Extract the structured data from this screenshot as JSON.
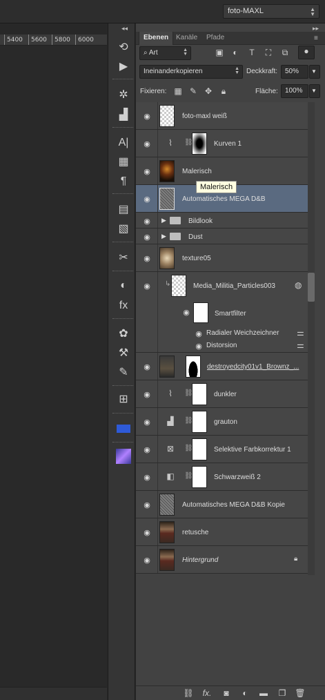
{
  "topbar": {
    "workspace": "foto-MAXL"
  },
  "ruler": {
    "ticks": [
      "5400",
      "5600",
      "5800",
      "6000"
    ]
  },
  "toolstrip": {
    "icons": [
      "history-icon",
      "play-action-icon",
      "navigator-icon",
      "histogram-icon",
      "character-icon",
      "3d-icon",
      "paragraph-icon",
      "notes-icon",
      "text-note-icon",
      "tool-presets-icon",
      "adjustments-icon",
      "styles-icon",
      "brush-presets-icon",
      "clone-source-icon",
      "brush-icon",
      "grid-icon",
      "swatch-icon",
      "plugin-icon"
    ]
  },
  "panel": {
    "tabs": [
      "Ebenen",
      "Kanäle",
      "Pfade"
    ],
    "filter_kind": "Art",
    "blend_mode": "Ineinanderkopieren",
    "opacity_label": "Deckkraft:",
    "opacity_value": "50%",
    "lock_label": "Fixieren:",
    "fill_label": "Fläche:",
    "fill_value": "100%"
  },
  "layers": [
    {
      "name": "foto-maxl weiß",
      "type": "pixel",
      "thumb": "transparent"
    },
    {
      "name": "Kurven 1",
      "type": "adjustment",
      "adj": "curves"
    },
    {
      "name": "Malerisch",
      "type": "pixel",
      "thumb": "fire"
    },
    {
      "name": "Automatisches MEGA D&B",
      "type": "pixel",
      "thumb": "noise",
      "selected": true
    },
    {
      "name": "Bildlook",
      "type": "group"
    },
    {
      "name": "Dust",
      "type": "group"
    },
    {
      "name": "texture05",
      "type": "pixel",
      "thumb": "dust"
    },
    {
      "name": "Media_Militia_Particles003",
      "type": "smart"
    },
    {
      "name": "Smartfilter",
      "type": "filtermask"
    },
    {
      "name": "Radialer Weichzeichner",
      "type": "filter"
    },
    {
      "name": "Distorsion",
      "type": "filter"
    },
    {
      "name": "destroyedcity01v1_Brownz_...",
      "type": "pixel-masked"
    },
    {
      "name": "dunkler",
      "type": "adjustment",
      "adj": "curves"
    },
    {
      "name": "grauton",
      "type": "adjustment",
      "adj": "levels"
    },
    {
      "name": "Selektive Farbkorrektur 1",
      "type": "adjustment",
      "adj": "selective"
    },
    {
      "name": "Schwarzweiß 2",
      "type": "adjustment",
      "adj": "bw"
    },
    {
      "name": "Automatisches MEGA D&B Kopie",
      "type": "pixel",
      "thumb": "noise"
    },
    {
      "name": "retusche",
      "type": "pixel",
      "thumb": "portrait"
    },
    {
      "name": "Hintergrund",
      "type": "background",
      "thumb": "portrait"
    }
  ],
  "tooltip": "Malerisch",
  "bottom_icons": [
    "link-layers-icon",
    "fx-icon",
    "add-mask-icon",
    "new-adjustment-icon",
    "new-group-icon",
    "new-layer-icon",
    "delete-layer-icon"
  ]
}
